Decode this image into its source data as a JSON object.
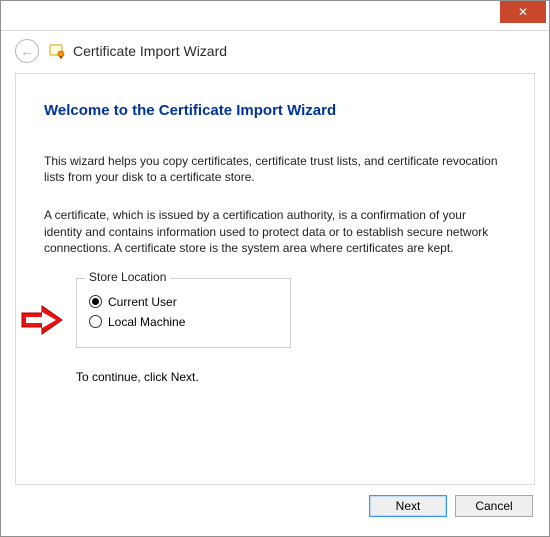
{
  "window": {
    "close_glyph": "✕"
  },
  "header": {
    "back_glyph": "←",
    "title": "Certificate Import Wizard"
  },
  "main": {
    "heading": "Welcome to the Certificate Import Wizard",
    "para1": "This wizard helps you copy certificates, certificate trust lists, and certificate revocation lists from your disk to a certificate store.",
    "para2": "A certificate, which is issued by a certification authority, is a confirmation of your identity and contains information used to protect data or to establish secure network connections. A certificate store is the system area where certificates are kept.",
    "store_location": {
      "legend": "Store Location",
      "options": {
        "current_user": "Current User",
        "local_machine": "Local Machine"
      },
      "selected": "current_user"
    },
    "continue_text": "To continue, click Next."
  },
  "footer": {
    "next": "Next",
    "cancel": "Cancel"
  }
}
